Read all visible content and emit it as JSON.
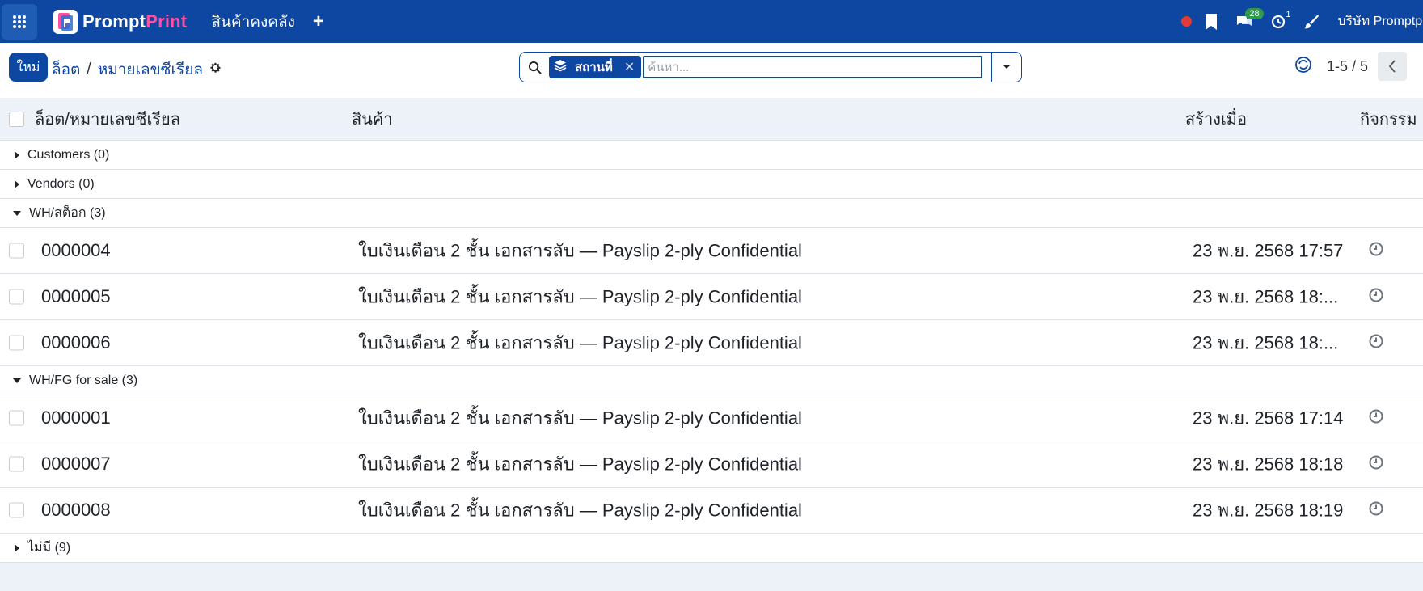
{
  "navbar": {
    "brand_prompt": "Prompt",
    "brand_print": "Print",
    "menu_label": "สินค้าคงคลัง",
    "plus_label": "+",
    "messages_count": "28",
    "activities_count": "1",
    "company_name": "บริษัท Promptpri",
    "brand_color": "#0d47a1",
    "accent_color": "#ff4fa3"
  },
  "control": {
    "new_label": "ใหม่",
    "breadcrumb_parent": "ล็อต",
    "breadcrumb_sep": "/",
    "breadcrumb_current": "หมายเลขซีเรียล",
    "facet_label": "สถานที่",
    "facet_remove": "✕",
    "search_placeholder": "ค้นหา...",
    "pager_text": "1-5 / 5"
  },
  "table": {
    "headers": {
      "lot": "ล็อต/หมายเลขซีเรียล",
      "product": "สินค้า",
      "created": "สร้างเมื่อ",
      "activity": "กิจกรรม"
    },
    "groups": [
      {
        "label": "Customers (0)",
        "expanded": false,
        "rows": []
      },
      {
        "label": "Vendors (0)",
        "expanded": false,
        "rows": []
      },
      {
        "label": "WH/สต็อก (3)",
        "expanded": true,
        "rows": [
          {
            "lot": "0000004",
            "product": "ใบเงินเดือน 2 ชั้น เอกสารลับ — Payslip 2-ply Confidential",
            "created": "23 พ.ย. 2568 17:57"
          },
          {
            "lot": "0000005",
            "product": "ใบเงินเดือน 2 ชั้น เอกสารลับ — Payslip 2-ply Confidential",
            "created": "23 พ.ย. 2568 18:..."
          },
          {
            "lot": "0000006",
            "product": "ใบเงินเดือน 2 ชั้น เอกสารลับ — Payslip 2-ply Confidential",
            "created": "23 พ.ย. 2568 18:..."
          }
        ]
      },
      {
        "label": "WH/FG for sale (3)",
        "expanded": true,
        "rows": [
          {
            "lot": "0000001",
            "product": "ใบเงินเดือน 2 ชั้น เอกสารลับ — Payslip 2-ply Confidential",
            "created": "23 พ.ย. 2568 17:14"
          },
          {
            "lot": "0000007",
            "product": "ใบเงินเดือน 2 ชั้น เอกสารลับ — Payslip 2-ply Confidential",
            "created": "23 พ.ย. 2568 18:18"
          },
          {
            "lot": "0000008",
            "product": "ใบเงินเดือน 2 ชั้น เอกสารลับ — Payslip 2-ply Confidential",
            "created": "23 พ.ย. 2568 18:19"
          }
        ]
      },
      {
        "label": "ไม่มี (9)",
        "expanded": false,
        "rows": []
      }
    ]
  }
}
